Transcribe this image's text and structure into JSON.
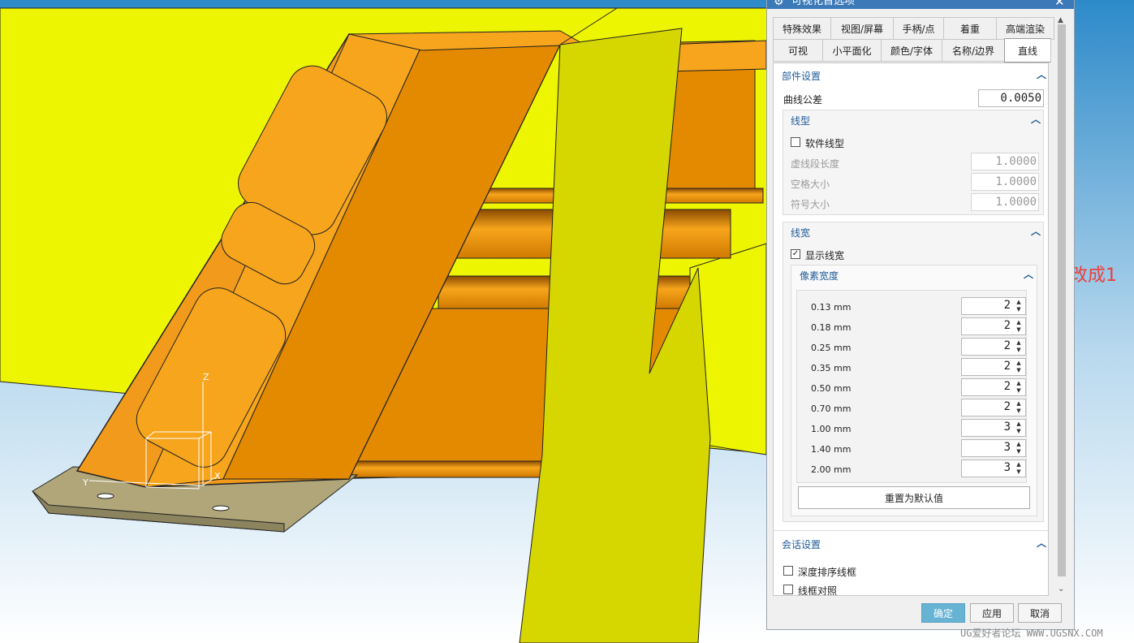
{
  "dialog": {
    "title": "可视化首选项",
    "gear_icon": "gear-icon",
    "close": "✕",
    "tabs_row1": [
      "特殊效果",
      "视图/屏幕",
      "手柄/点",
      "着重",
      "高端渲染"
    ],
    "tabs_row2": [
      "可视",
      "小平面化",
      "颜色/字体",
      "名称/边界",
      "直线"
    ],
    "active_tab": "直线"
  },
  "part_settings": {
    "title": "部件设置",
    "curve_tolerance_label": "曲线公差",
    "curve_tolerance_value": "0.0050"
  },
  "line_type": {
    "title": "线型",
    "software_line_label": "软件线型",
    "software_line_checked": false,
    "dash_length_label": "虚线段长度",
    "dash_length_value": "1.0000",
    "space_size_label": "空格大小",
    "space_size_value": "1.0000",
    "symbol_size_label": "符号大小",
    "symbol_size_value": "1.0000"
  },
  "line_width": {
    "title": "线宽",
    "show_width_label": "显示线宽",
    "show_width_checked": true,
    "pixel_width_title": "像素宽度",
    "rows": [
      {
        "mm": "0.13 mm",
        "px": "2"
      },
      {
        "mm": "0.18 mm",
        "px": "2"
      },
      {
        "mm": "0.25 mm",
        "px": "2"
      },
      {
        "mm": "0.35 mm",
        "px": "2"
      },
      {
        "mm": "0.50 mm",
        "px": "2"
      },
      {
        "mm": "0.70 mm",
        "px": "2"
      },
      {
        "mm": "1.00 mm",
        "px": "3"
      },
      {
        "mm": "1.40 mm",
        "px": "3"
      },
      {
        "mm": "2.00 mm",
        "px": "3"
      }
    ],
    "reset_button": "重置为默认值"
  },
  "session_settings": {
    "title": "会话设置",
    "depth_sort_label": "深度排序线框",
    "depth_sort_checked": false,
    "wireframe_contrast_label": "线框对照",
    "wireframe_contrast_checked": false
  },
  "buttons": {
    "ok": "确定",
    "apply": "应用",
    "cancel": "取消"
  },
  "annotation": {
    "text": "改成1",
    "color": "#e8403f"
  },
  "watermark": "UG爱好者论坛 WWW.UGSNX.COM",
  "axes": {
    "z": "Z",
    "y": "Y",
    "x": "X"
  },
  "colors": {
    "accent_blue": "#3b79b8",
    "ok_button": "#67b3d4",
    "model_orange": "#f29a1b",
    "model_yellow": "#eef500",
    "model_olive": "#d6d600"
  }
}
